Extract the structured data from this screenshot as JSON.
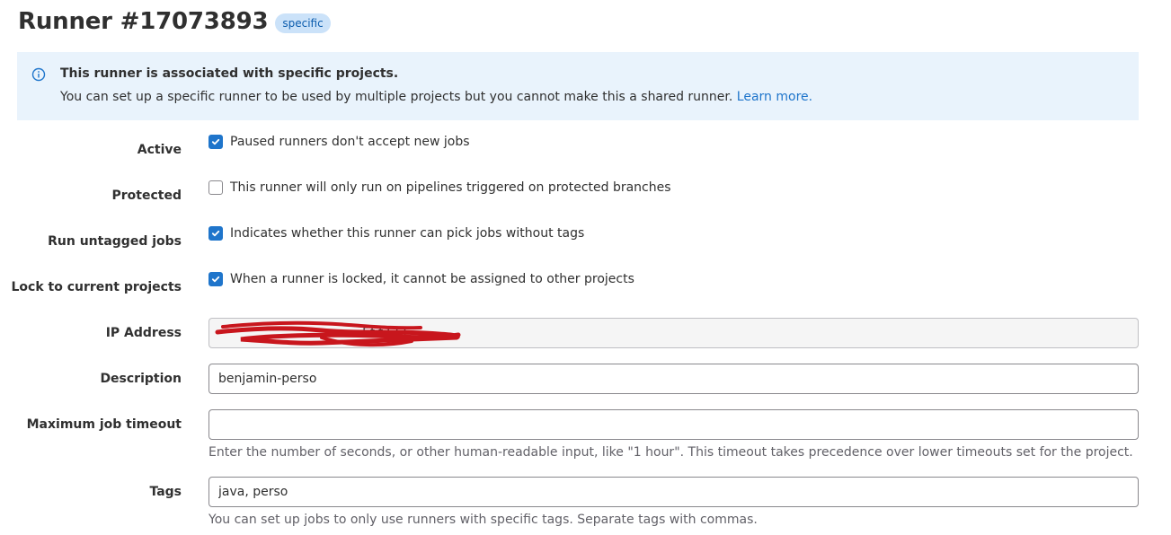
{
  "header": {
    "title": "Runner #17073893",
    "badge": "specific"
  },
  "alert": {
    "icon": "info-icon",
    "title": "This runner is associated with specific projects.",
    "body": "You can set up a specific runner to be used by multiple projects but you cannot make this a shared runner.",
    "link_text": "Learn more."
  },
  "form": {
    "active": {
      "label": "Active",
      "checked": true,
      "text": "Paused runners don't accept new jobs"
    },
    "protected": {
      "label": "Protected",
      "checked": false,
      "text": "This runner will only run on pipelines triggered on protected branches"
    },
    "run_untagged": {
      "label": "Run untagged jobs",
      "checked": true,
      "text": "Indicates whether this runner can pick jobs without tags"
    },
    "lock_projects": {
      "label": "Lock to current projects",
      "checked": true,
      "text": "When a runner is locked, it cannot be assigned to other projects"
    },
    "ip_address": {
      "label": "IP Address",
      "value": "5f:f733"
    },
    "description": {
      "label": "Description",
      "value": "benjamin-perso"
    },
    "max_timeout": {
      "label": "Maximum job timeout",
      "value": "",
      "help": "Enter the number of seconds, or other human-readable input, like \"1 hour\". This timeout takes precedence over lower timeouts set for the project."
    },
    "tags": {
      "label": "Tags",
      "value": "java, perso",
      "help": "You can set up jobs to only use runners with specific tags. Separate tags with commas."
    }
  },
  "colors": {
    "accent": "#1f75cb",
    "alert_bg": "#e9f3fc",
    "badge_bg": "#cbe2f9",
    "redaction": "#c8161d"
  }
}
